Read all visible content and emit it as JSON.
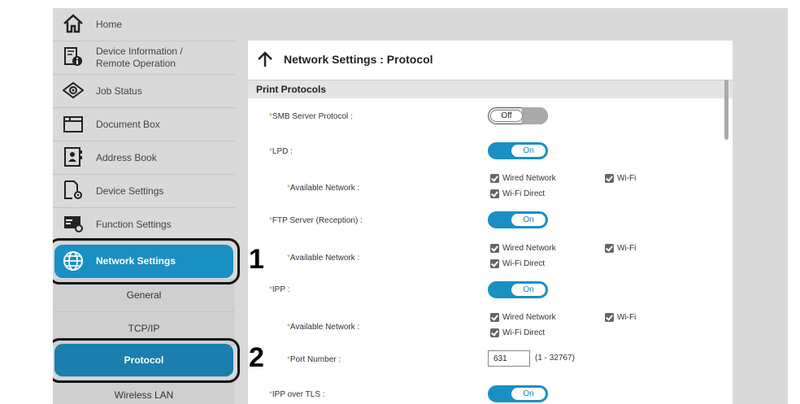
{
  "sidebar": {
    "items": [
      {
        "label": "Home",
        "icon": "home-icon"
      },
      {
        "label_line1": "Device Information /",
        "label_line2": "Remote Operation",
        "icon": "device-info-icon"
      },
      {
        "label": "Job Status",
        "icon": "job-status-icon"
      },
      {
        "label": "Document Box",
        "icon": "document-box-icon"
      },
      {
        "label": "Address Book",
        "icon": "address-book-icon"
      },
      {
        "label": "Device Settings",
        "icon": "device-settings-icon"
      },
      {
        "label": "Function Settings",
        "icon": "function-settings-icon"
      },
      {
        "label": "Network Settings",
        "icon": "globe-icon",
        "active": true
      }
    ],
    "subitems": [
      {
        "label": "General"
      },
      {
        "label": "TCP/IP"
      },
      {
        "label": "Protocol",
        "active": true
      },
      {
        "label": "Wireless LAN"
      }
    ]
  },
  "callouts": {
    "one": "1",
    "two": "2"
  },
  "main": {
    "title": "Network Settings : Protocol",
    "section": "Print Protocols",
    "required_mark": "*",
    "rows": {
      "smb": {
        "label": "SMB Server Protocol :",
        "toggle": "Off"
      },
      "lpd": {
        "label": "LPD :",
        "toggle": "On"
      },
      "lpd_net": {
        "label": "Available Network :"
      },
      "ftp": {
        "label": "FTP Server (Reception) :",
        "toggle": "On"
      },
      "ftp_net": {
        "label": "Available Network :"
      },
      "ipp": {
        "label": "IPP :",
        "toggle": "On"
      },
      "ipp_net": {
        "label": "Available Network :"
      },
      "port": {
        "label": "Port Number :",
        "value": "631",
        "range": "(1 - 32767)"
      },
      "ipptls": {
        "label": "IPP over TLS :",
        "toggle": "On"
      }
    },
    "networks": {
      "wired": "Wired Network",
      "wifi": "Wi-Fi",
      "wifi_direct": "Wi-Fi Direct"
    }
  },
  "colors": {
    "accent": "#1a8fc4",
    "required": "#e08a2a"
  }
}
